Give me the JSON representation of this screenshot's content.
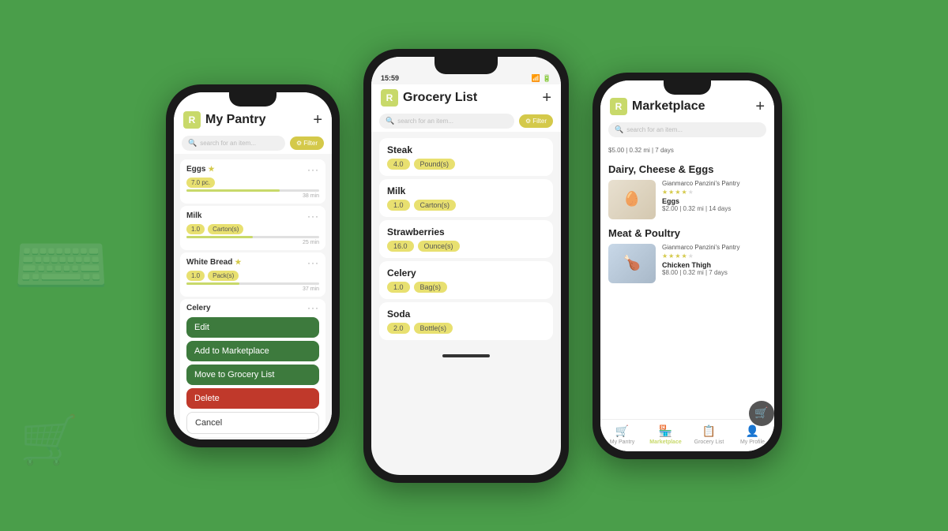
{
  "background": "#4a9e4a",
  "phone1": {
    "title": "My Pantry",
    "search_placeholder": "search for an item...",
    "filter_label": "Filter",
    "items": [
      {
        "name": "Eggs",
        "starred": true,
        "quantity": "7.0",
        "unit": "pc.",
        "time": "38 min",
        "progress": 70
      },
      {
        "name": "Milk",
        "starred": false,
        "quantity": "1.0",
        "unit": "Carton(s)",
        "time": "25 min",
        "progress": 50
      },
      {
        "name": "White Bread",
        "starred": true,
        "quantity": "1.0",
        "unit": "Pack(s)",
        "time": "37 min",
        "progress": 40
      }
    ],
    "context_item": "Celery",
    "menu": {
      "edit": "Edit",
      "marketplace": "Add to Marketplace",
      "grocery": "Move to Grocery List",
      "delete": "Delete",
      "cancel": "Cancel"
    }
  },
  "phone2": {
    "status_time": "15:59",
    "title": "Grocery List",
    "search_placeholder": "search for an item...",
    "filter_label": "Filter",
    "items": [
      {
        "name": "Steak",
        "quantity": "4.0",
        "unit": "Pound(s)"
      },
      {
        "name": "Milk",
        "quantity": "1.0",
        "unit": "Carton(s)"
      },
      {
        "name": "Strawberries",
        "quantity": "16.0",
        "unit": "Ounce(s)"
      },
      {
        "name": "Celery",
        "quantity": "1.0",
        "unit": "Bag(s)"
      },
      {
        "name": "Soda",
        "quantity": "2.0",
        "unit": "Bottle(s)"
      }
    ]
  },
  "phone3": {
    "title": "Marketplace",
    "search_placeholder": "search for an item...",
    "top_listing": "$5.00 | 0.32 mi | 7 days",
    "categories": [
      {
        "name": "Dairy, Cheese & Eggs",
        "listings": [
          {
            "seller": "Gianmarco Panzini's Pantry",
            "product": "Eggs",
            "price": "$2.00 | 0.32 mi | 14 days",
            "stars": 4,
            "img_type": "egg"
          }
        ]
      },
      {
        "name": "Meat & Poultry",
        "listings": [
          {
            "seller": "Gianmarco Panzini's Pantry",
            "product": "Chicken Thigh",
            "price": "$8.00 | 0.32 mi | 7 days",
            "stars": 4,
            "img_type": "chicken"
          }
        ]
      }
    ],
    "nav": [
      {
        "label": "My Pantry",
        "icon": "🛒",
        "active": false
      },
      {
        "label": "Marketplace",
        "icon": "🏪",
        "active": true
      },
      {
        "label": "Grocery List",
        "icon": "📋",
        "active": false
      },
      {
        "label": "My Profile",
        "icon": "👤",
        "active": false
      }
    ]
  }
}
